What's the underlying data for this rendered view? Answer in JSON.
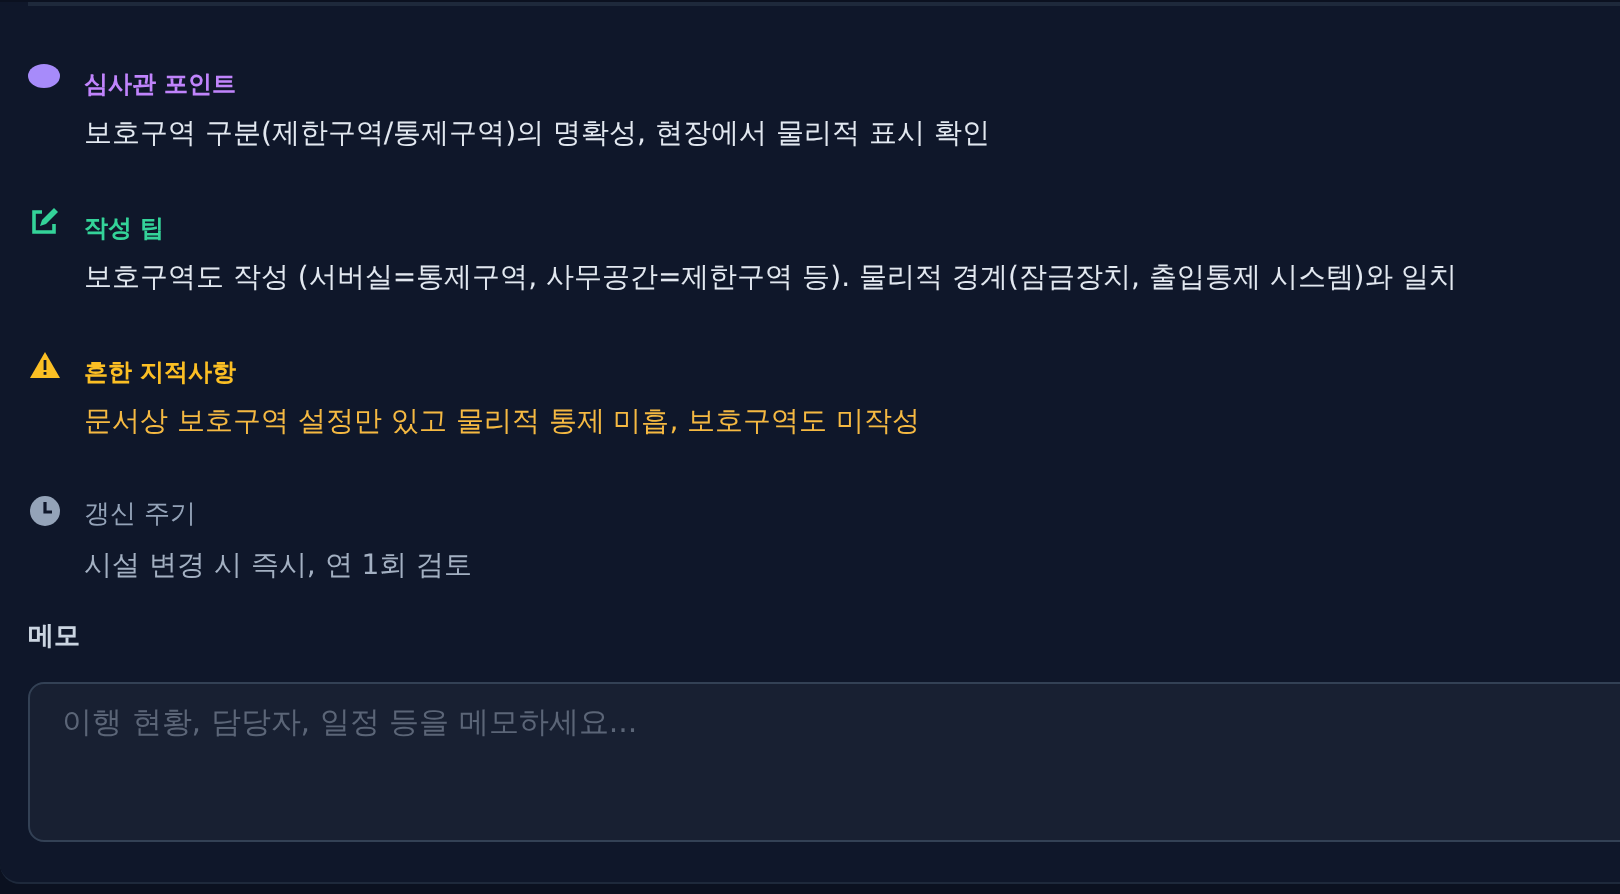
{
  "guide_items": [
    {
      "kind": "reviewer",
      "title": "심사관 포인트",
      "text": "보호구역 구분(제한구역/통제구역)의 명확성, 현장에서 물리적 표시 확인"
    },
    {
      "kind": "tip",
      "title": "작성 팁",
      "text": "보호구역도 작성 (서버실=통제구역, 사무공간=제한구역 등). 물리적 경계(잠금장치, 출입통제 시스템)와 일치"
    },
    {
      "kind": "warning",
      "title": "흔한 지적사항",
      "text": "문서상 보호구역 설정만 있고 물리적 통제 미흡, 보호구역도 미작성"
    },
    {
      "kind": "cycle",
      "title": "갱신 주기",
      "text": "시설 변경 시 즉시, 연 1회 검토"
    }
  ],
  "memo": {
    "label": "메모",
    "placeholder": "이행 현황, 담당자, 일정 등을 메모하세요..."
  }
}
